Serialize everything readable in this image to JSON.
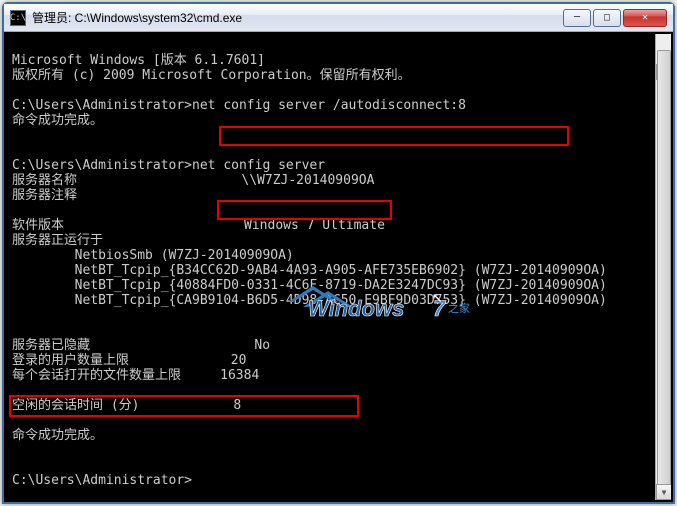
{
  "window": {
    "icon_text": "C:\\",
    "title": "管理员: C:\\Windows\\system32\\cmd.exe"
  },
  "term": {
    "l1": "Microsoft Windows [版本 6.1.7601]",
    "l2": "版权所有 (c) 2009 Microsoft Corporation。保留所有权利。",
    "p1": "C:\\Users\\Administrator>",
    "cmd1": "net config server /autodisconnect:8",
    "r1": "命令成功完成。",
    "p2": "C:\\Users\\Administrator>",
    "cmd2": "net config server",
    "row_name_l": "服务器名称",
    "row_name_v": "\\\\W7ZJ-20140909OA",
    "row_comment": "服务器注释",
    "row_sw_l": "软件版本",
    "row_sw_v": "Windows 7 Ultimate",
    "row_active": "服务器正运行于",
    "nb1": "        NetbiosSmb (W7ZJ-20140909OA)",
    "nb2": "        NetBT_Tcpip_{B34CC62D-9AB4-4A93-A905-AFE735EB6902} (W7ZJ-20140909OA)",
    "nb3": "        NetBT_Tcpip_{40884FD0-0331-4C6F-8719-DA2E3247DC93} (W7ZJ-20140909OA)",
    "nb4": "        NetBT_Tcpip_{CA9B9104-B6D5-4D98-AC50-E9BF9D03D753} (W7ZJ-20140909OA)",
    "row_hidden_l": "服务器已隐藏",
    "row_hidden_v": "No",
    "row_users_l": "登录的用户数量上限",
    "row_users_v": "20",
    "row_files_l": "每个会话打开的文件数量上限",
    "row_files_v": "16384",
    "row_idle_l": "空闲的会话时间 (分)",
    "row_idle_v": "8",
    "r2": "命令成功完成。",
    "p3": "C:\\Users\\Administrator>"
  },
  "watermark": "Windows7en"
}
